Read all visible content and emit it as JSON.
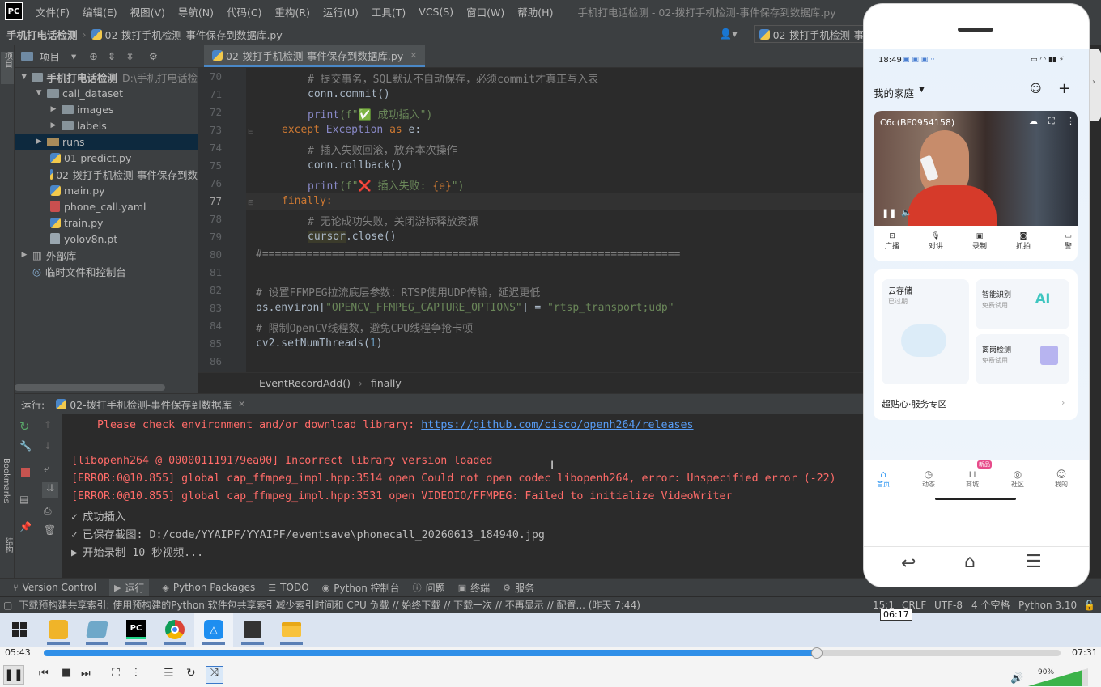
{
  "menubar": {
    "logo": "PC",
    "items": [
      "文件(F)",
      "编辑(E)",
      "视图(V)",
      "导航(N)",
      "代码(C)",
      "重构(R)",
      "运行(U)",
      "工具(T)",
      "VCS(S)",
      "窗口(W)",
      "帮助(H)"
    ],
    "title": "手机打电话检测 - 02-拨打手机检测-事件保存到数据库.py"
  },
  "navbar": {
    "project": "手机打电话检测",
    "file": "02-拨打手机检测-事件保存到数据库.py",
    "run_config": "02-拨打手机检测-事"
  },
  "sidebar_left": {
    "project_tab": "项目",
    "bookmarks": "Bookmarks",
    "structure": "结构"
  },
  "project_panel": {
    "title": "项目",
    "root": {
      "name": "手机打电话检测",
      "path": "D:\\手机打电话检"
    },
    "items": [
      {
        "name": "call_dataset",
        "type": "folder"
      },
      {
        "name": "images",
        "type": "folder"
      },
      {
        "name": "labels",
        "type": "folder"
      },
      {
        "name": "runs",
        "type": "folder"
      },
      {
        "name": "01-predict.py",
        "type": "py"
      },
      {
        "name": "02-拨打手机检测-事件保存到数",
        "type": "py"
      },
      {
        "name": "main.py",
        "type": "py"
      },
      {
        "name": "phone_call.yaml",
        "type": "yaml"
      },
      {
        "name": "train.py",
        "type": "py"
      },
      {
        "name": "yolov8n.pt",
        "type": "file"
      },
      {
        "name": "外部库",
        "type": "lib"
      },
      {
        "name": "临时文件和控制台",
        "type": "scratch"
      }
    ]
  },
  "editor": {
    "tab": "02-拨打手机检测-事件保存到数据库.py",
    "line_numbers": [
      "70",
      "71",
      "72",
      "73",
      "74",
      "75",
      "76",
      "77",
      "78",
      "79",
      "80",
      "81",
      "82",
      "83",
      "84",
      "85",
      "86"
    ],
    "lines": {
      "l70": "# 提交事务，SQL默认不自动保存，必须commit才真正写入表",
      "l71": "conn.commit()",
      "l72_fn": "print",
      "l72_str": "(f\"✅ 成功插入\")",
      "l73_kw": "except",
      "l73_cls": " Exception ",
      "l73_as": "as",
      "l73_var": " e:",
      "l74": "# 插入失败回滚，放弃本次操作",
      "l75": "conn.rollback()",
      "l76_fn": "print",
      "l76_str1": "(f\"❌ 插入失败: ",
      "l76_var": "{e}",
      "l76_str2": "\")",
      "l77": "finally:",
      "l78": "# 无论成功失败，关闭游标释放资源",
      "l79_var": "cursor",
      "l79_rest": ".close()",
      "l80": "#==================================================================",
      "l82": "# 设置FFMPEG拉流底层参数：RTSP使用UDP传输，延迟更低",
      "l83_a": "os.environ[",
      "l83_key": "\"OPENCV_FFMPEG_CAPTURE_OPTIONS\"",
      "l83_b": "] = ",
      "l83_val": "\"rtsp_transport;udp\"",
      "l84": "# 限制OpenCV线程数，避免CPU线程争抢卡顿",
      "l85_a": "cv2.setNumThreads(",
      "l85_num": "1",
      "l85_b": ")"
    },
    "breadcrumb": [
      "EventRecordAdd()",
      "finally"
    ]
  },
  "run": {
    "label": "运行:",
    "tab": "02-拨打手机检测-事件保存到数据库",
    "console": {
      "c1_text": "    Please check environment and/or download library: ",
      "c1_link": "https://github.com/cisco/openh264/releases",
      "c2": "[libopenh264 @ 000001119179ea00] Incorrect library version loaded",
      "c3": "[ERROR:0@10.855] global cap_ffmpeg_impl.hpp:3514 open Could not open codec libopenh264, error: Unspecified error (-22)",
      "c4": "[ERROR:0@10.855] global cap_ffmpeg_impl.hpp:3531 open VIDEOIO/FFMPEG: Failed to initialize VideoWriter",
      "c5": "成功插入",
      "c6": "已保存截图: D:/code/YYAIPF/YYAIPF/eventsave\\phonecall_20260613_184940.jpg",
      "c7": "开始录制 10 秒视频..."
    }
  },
  "toolwindows": [
    "Version Control",
    "运行",
    "Python Packages",
    "TODO",
    "Python 控制台",
    "问题",
    "终端",
    "服务"
  ],
  "statusbar": {
    "message": "下载预构建共享索引: 使用预构建的Python 软件包共享索引减少索引时间和 CPU 负载 // 始终下载 // 下载一次 // 不再显示 // 配置... (昨天 7:44)",
    "position": "15:1",
    "line_sep": "CRLF",
    "encoding": "UTF-8",
    "indent": "4 个空格",
    "interpreter": "Python 3.10"
  },
  "player": {
    "elapsed": "05:43",
    "total": "07:31",
    "hover_time": "06:17",
    "progress": 0.76,
    "volume": "90%",
    "volume_level": 0.9
  },
  "phone": {
    "time": "18:49",
    "home_title": "我的家庭",
    "camera_name": "C6c(BF0954158)",
    "camera_controls": [
      "广播",
      "对讲",
      "录制",
      "抓拍",
      "警"
    ],
    "cards": {
      "cloud": "云存储",
      "cloud_sub": "已过期",
      "smart": "智能识别",
      "smart_sub": "免费试用",
      "leave": "离岗检测",
      "leave_sub": "免费试用"
    },
    "service": "超贴心·服务专区",
    "bottom_nav": [
      "首页",
      "动态",
      "商城",
      "社区",
      "我的"
    ],
    "new_badge": "新品"
  }
}
